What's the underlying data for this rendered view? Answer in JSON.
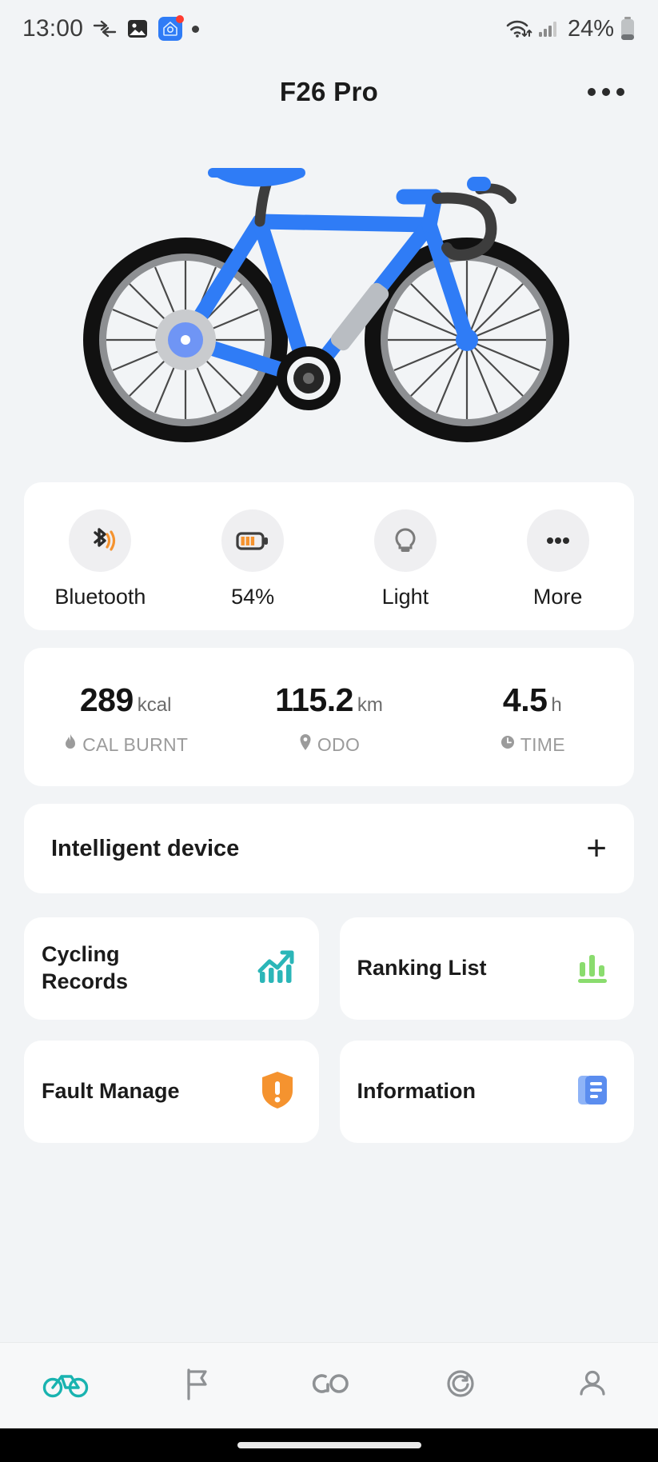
{
  "status_bar": {
    "time": "13:00",
    "battery_percent": "24%",
    "icons": [
      "transfer-arrows-icon",
      "gallery-image-icon",
      "app-notification-icon",
      "dot-icon",
      "wifi-icon",
      "cellular-signal-icon",
      "battery-icon"
    ]
  },
  "header": {
    "title": "F26 Pro",
    "more_label": "more-options"
  },
  "hero": {
    "alt": "blue-road-bicycle-illustration",
    "frame_color": "#2f7cf6",
    "tire_color": "#111111"
  },
  "quick_actions": [
    {
      "label": "Bluetooth",
      "icon": "bluetooth-icon"
    },
    {
      "label": "54%",
      "icon": "battery-level-icon"
    },
    {
      "label": "Light",
      "icon": "lightbulb-icon"
    },
    {
      "label": "More",
      "icon": "ellipsis-icon"
    }
  ],
  "stats": [
    {
      "value": "289",
      "unit": "kcal",
      "caption": "CAL BURNT",
      "icon": "flame-icon"
    },
    {
      "value": "115.2",
      "unit": "km",
      "caption": "ODO",
      "icon": "location-pin-icon"
    },
    {
      "value": "4.5",
      "unit": "h",
      "caption": "TIME",
      "icon": "clock-icon"
    }
  ],
  "intelligent_device": {
    "title": "Intelligent device",
    "add_label": "+"
  },
  "tiles": [
    {
      "label": "Cycling Records",
      "icon": "trend-chart-icon",
      "color": "#2bb6b8"
    },
    {
      "label": "Ranking List",
      "icon": "bar-chart-icon",
      "color": "#8adc6e"
    },
    {
      "label": "Fault Manage",
      "icon": "warning-shield-icon",
      "color": "#f59331"
    },
    {
      "label": "Information",
      "icon": "documents-icon",
      "color": "#5b8def"
    }
  ],
  "bottom_nav": [
    {
      "name": "bike",
      "icon": "bicycle-icon",
      "active": true
    },
    {
      "name": "flag",
      "icon": "flag-icon",
      "active": false
    },
    {
      "name": "go",
      "icon": "go-icon",
      "active": false
    },
    {
      "name": "speedometer",
      "icon": "speedometer-icon",
      "active": false
    },
    {
      "name": "profile",
      "icon": "person-icon",
      "active": false
    }
  ],
  "colors": {
    "accent": "#2f7cf6",
    "nav_active": "#19b3b0",
    "background": "#f2f4f6",
    "card": "#ffffff"
  }
}
